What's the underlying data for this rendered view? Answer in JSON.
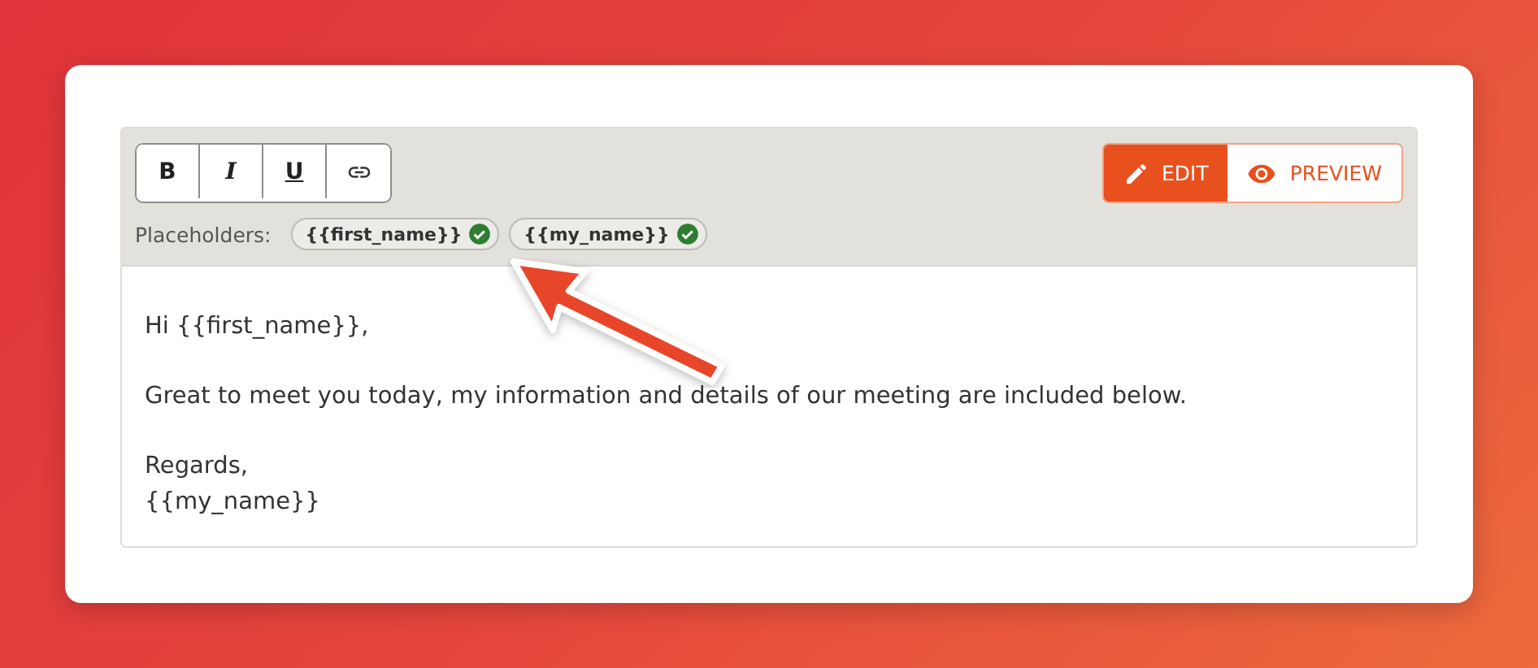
{
  "toolbar": {
    "format_buttons": [
      {
        "kind": "bold",
        "label": "B"
      },
      {
        "kind": "italic",
        "label": "I"
      },
      {
        "kind": "underline",
        "label": "U"
      },
      {
        "kind": "link"
      }
    ],
    "modes": [
      {
        "kind": "edit",
        "label": "EDIT",
        "selected": true
      },
      {
        "kind": "preview",
        "label": "PREVIEW",
        "selected": false
      }
    ],
    "placeholders_label": "Placeholders:",
    "placeholders": [
      {
        "label": "{{first_name}}",
        "valid": true
      },
      {
        "label": "{{my_name}}",
        "valid": true
      }
    ]
  },
  "body": {
    "paragraphs": [
      [
        "Hi {{first_name}},"
      ],
      [
        "Great to meet you today, my information and details of our meeting are included below."
      ],
      [
        "Regards,",
        "{{my_name}}"
      ]
    ]
  },
  "annotation": {
    "kind": "arrow"
  }
}
